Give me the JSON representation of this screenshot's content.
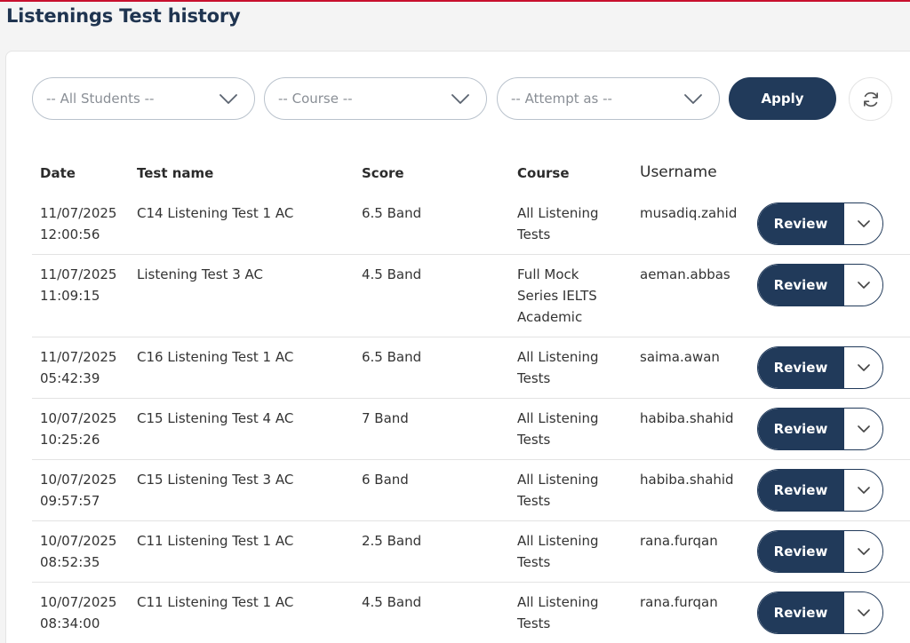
{
  "page": {
    "title": "Listenings Test history"
  },
  "filters": {
    "students_placeholder": "-- All Students --",
    "course_placeholder": "-- Course --",
    "attempt_placeholder": "-- Attempt as --",
    "apply_label": "Apply"
  },
  "table": {
    "headers": {
      "date": "Date",
      "test": "Test name",
      "score": "Score",
      "course": "Course",
      "username": "Username"
    },
    "review_label": "Review",
    "rows": [
      {
        "date": "11/07/2025",
        "time": "12:00:56",
        "test": "C14 Listening Test 1 AC",
        "score": "6.5 Band",
        "course": "All Listening Tests",
        "username": "musadiq.zahid"
      },
      {
        "date": "11/07/2025",
        "time": "11:09:15",
        "test": "Listening Test 3 AC",
        "score": "4.5 Band",
        "course": "Full Mock Series IELTS Academic",
        "username": "aeman.abbas"
      },
      {
        "date": "11/07/2025",
        "time": "05:42:39",
        "test": "C16 Listening Test 1 AC",
        "score": "6.5 Band",
        "course": "All Listening Tests",
        "username": "saima.awan"
      },
      {
        "date": "10/07/2025",
        "time": "10:25:26",
        "test": "C15 Listening Test 4 AC",
        "score": "7 Band",
        "course": "All Listening Tests",
        "username": "habiba.shahid"
      },
      {
        "date": "10/07/2025",
        "time": "09:57:57",
        "test": "C15 Listening Test 3 AC",
        "score": "6 Band",
        "course": "All Listening Tests",
        "username": "habiba.shahid"
      },
      {
        "date": "10/07/2025",
        "time": "08:52:35",
        "test": "C11 Listening Test 1 AC",
        "score": "2.5 Band",
        "course": "All Listening Tests",
        "username": "rana.furqan"
      },
      {
        "date": "10/07/2025",
        "time": "08:34:00",
        "test": "C11 Listening Test 1 AC",
        "score": "4.5 Band",
        "course": "All Listening Tests",
        "username": "rana.furqan"
      }
    ]
  },
  "colors": {
    "primary": "#213a5a",
    "title": "#1f3450",
    "accent_line": "#c8102e"
  },
  "icons": {
    "dropdown": "chevron-down-icon",
    "refresh": "refresh-icon"
  }
}
